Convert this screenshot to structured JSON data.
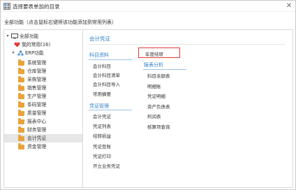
{
  "window": {
    "title": "选择要表单加的目录",
    "close_glyph": "✕"
  },
  "hint": "全部功能（点击鼠标右键将该功能添加到常用列表）",
  "tree": {
    "root": {
      "label": "全部功能",
      "toggle": "▾"
    },
    "favorites": {
      "label": "我的常用(16)"
    },
    "erp": {
      "label": "ERP功能",
      "toggle": "▾"
    },
    "folders": [
      "系统管理",
      "仓库管理",
      "采购管理",
      "销售管理",
      "生产管理",
      "条码管理",
      "质量管理",
      "报表中心",
      "财务管理",
      "会计凭证",
      "资金管理"
    ],
    "selected": "会计凭证"
  },
  "right": {
    "title": "会计凭证",
    "col1": {
      "sections": [
        {
          "heading": "科目资料",
          "items": [
            "会计科目",
            "会计科目清单",
            "会计科目导入",
            "常用摘要"
          ]
        },
        {
          "heading": "凭证管理",
          "items": [
            "会计凭证",
            "凭证列表",
            "结转损益",
            "凭证登账",
            "凭证打印",
            "开立业务凭证"
          ]
        }
      ]
    },
    "col2": {
      "top_item": "年度结转",
      "sections": [
        {
          "heading": "报表分析",
          "items": [
            "科目余额表",
            "明细账",
            "凭证明细",
            "资产负债表",
            "利润表",
            "核算项查询"
          ]
        }
      ]
    }
  },
  "colors": {
    "accent": "#2f80c8",
    "highlight": "#e53935",
    "folder": "#e8a33b",
    "favorite": "#e53935"
  }
}
